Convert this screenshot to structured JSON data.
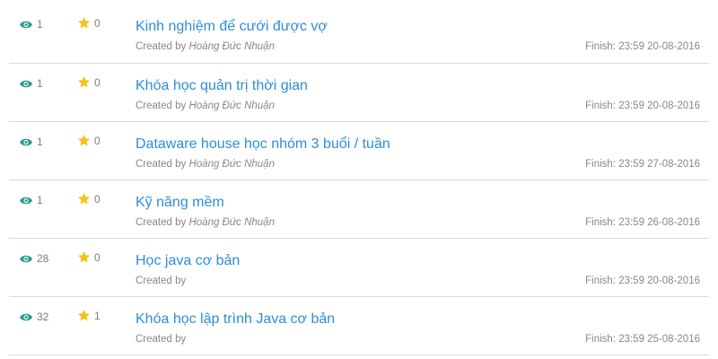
{
  "colors": {
    "link": "#2e8ed3",
    "eye_icon": "#2a9a8c",
    "star_icon": "#f3c317",
    "meta_text": "#888888",
    "divider": "#d9d9d9"
  },
  "icons": {
    "views": "eye-icon",
    "rating": "star-icon"
  },
  "tasks": [
    {
      "views": "1",
      "stars": "0",
      "title": "Kinh nghiệm để cưới được vợ",
      "created_label": "Created by",
      "author": "Hoàng Đức Nhuận",
      "finish": "Finish: 23:59 20-08-2016"
    },
    {
      "views": "1",
      "stars": "0",
      "title": "Khóa học quản trị thời gian",
      "created_label": "Created by",
      "author": "Hoàng Đức Nhuận",
      "finish": "Finish: 23:59 20-08-2016"
    },
    {
      "views": "1",
      "stars": "0",
      "title": "Dataware house học nhóm 3 buổi / tuần",
      "created_label": "Created by",
      "author": "Hoàng Đức Nhuận",
      "finish": "Finish: 23:59 27-08-2016"
    },
    {
      "views": "1",
      "stars": "0",
      "title": "Kỹ năng mềm",
      "created_label": "Created by",
      "author": "Hoàng Đức Nhuận",
      "finish": "Finish: 23:59 26-08-2016"
    },
    {
      "views": "28",
      "stars": "0",
      "title": "Học java cơ bản",
      "created_label": "Created by",
      "author": "",
      "finish": "Finish: 23:59 20-08-2016"
    },
    {
      "views": "32",
      "stars": "1",
      "title": "Khóa học lập trình Java cơ bản",
      "created_label": "Created by",
      "author": "",
      "finish": "Finish: 23:59 25-08-2016"
    }
  ]
}
